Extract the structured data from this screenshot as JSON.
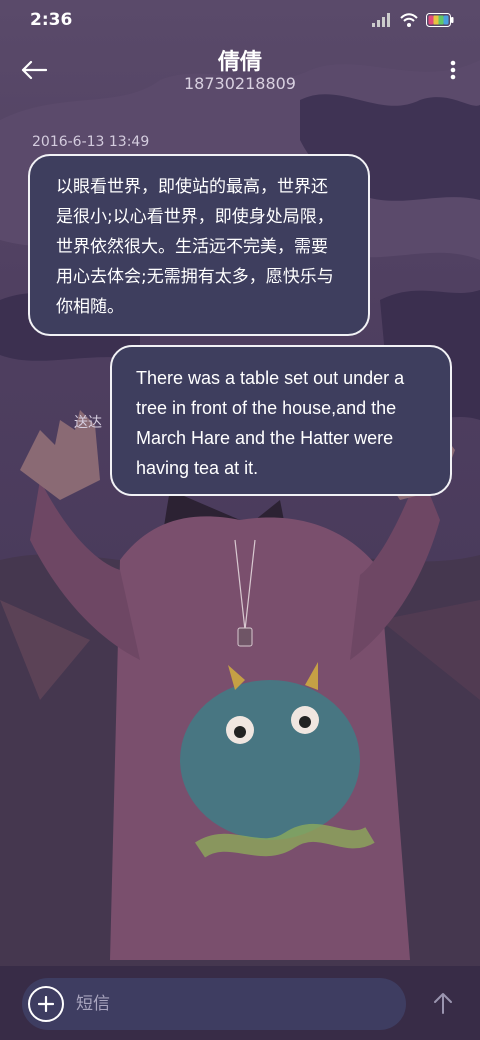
{
  "status_bar": {
    "time": "2:36"
  },
  "header": {
    "contact_name": "倩倩",
    "contact_number": "18730218809"
  },
  "conversation": {
    "timestamp": "2016-6-13 13:49",
    "messages": [
      {
        "direction": "incoming",
        "text": "以眼看世界，即使站的最高，世界还是很小;以心看世界，即使身处局限，世界依然很大。生活远不完美，需要用心去体会;无需拥有太多，愿快乐与你相随。"
      },
      {
        "direction": "outgoing",
        "text": "There was a table set out under a tree in front of the house,and the March Hare and the Hatter were having tea at it.",
        "status": "送达"
      }
    ]
  },
  "composer": {
    "placeholder": "短信"
  },
  "icons": {
    "back": "arrow-left-icon",
    "more": "more-vertical-icon",
    "add": "plus-icon",
    "send": "arrow-up-icon",
    "signal": "signal-icon",
    "wifi": "wifi-icon",
    "battery": "battery-icon"
  },
  "colors": {
    "bubble_fill": "#3e3e5e",
    "bubble_border": "#f2f2f6",
    "background": "#4f3f60"
  }
}
